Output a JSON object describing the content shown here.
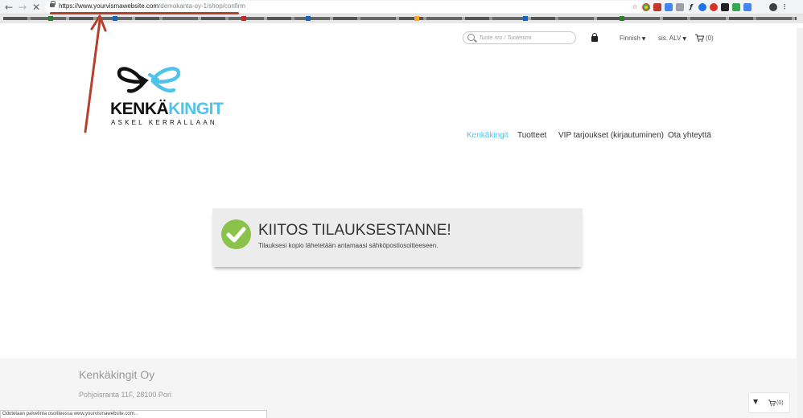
{
  "browser": {
    "url_domain": "https://www.yourvismawebsite.com",
    "url_path": "/demokanta-oy-1/shop/confirm",
    "back_glyph": "←",
    "forward_glyph": "→",
    "stop_glyph": "✕",
    "star_glyph": "☆",
    "menu_glyph": "⋮",
    "status_text": "Odotetaan palvelinta osoitteessa www.yourvismawebsite.com..."
  },
  "header": {
    "search_placeholder": "Tuote nro / Tuotenimi",
    "language": "Finnish",
    "tax_mode": "sis. ALV",
    "cart_count": "(0)"
  },
  "logo": {
    "word_part1": "KENKÄ",
    "word_part2": "KINGIT",
    "tagline": "ASKEL KERRALLAAN",
    "colors": {
      "dark": "#111111",
      "accent": "#4fc3e8"
    }
  },
  "nav": {
    "items": [
      {
        "label": "Kenkäkingit",
        "active": true
      },
      {
        "label": "Tuotteet",
        "active": false
      },
      {
        "label": "VIP tarjoukset (kirjautuminen)",
        "active": false
      },
      {
        "label": "Ota yhteyttä",
        "active": false
      }
    ]
  },
  "confirmation": {
    "title": "KIITOS TILAUKSESTANNE!",
    "message": "Tilauksesi kopio lähetetään antamaasi sähköpostiosoitteeseen.",
    "check_color": "#8bc34a"
  },
  "footer": {
    "company": "Kenkäkingit Oy",
    "address": "Pohjoisranta 11F, 28100 Pori"
  },
  "floating_cart": {
    "caret_glyph": "▼",
    "count": "(0)"
  },
  "annotation": {
    "color": "#b4412c"
  }
}
